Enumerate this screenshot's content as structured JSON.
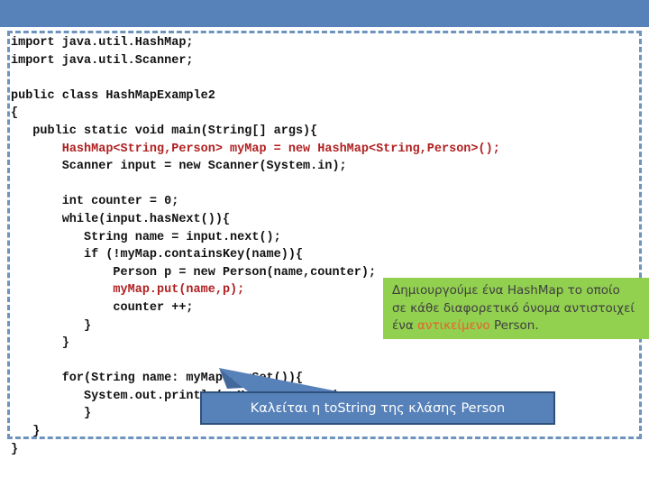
{
  "slide": {
    "header_bar_color": "#5681B9",
    "frame_border_color": "#6E94BE",
    "background": "#ffffff"
  },
  "code": {
    "language": "java",
    "default_color": "#111111",
    "highlight_color": "#B02020",
    "lines": [
      {
        "text": "import java.util.HashMap;",
        "segments": [
          {
            "t": "import java.util.HashMap;",
            "c": "default"
          }
        ]
      },
      {
        "text": "import java.util.Scanner;",
        "segments": [
          {
            "t": "import java.util.Scanner;",
            "c": "default"
          }
        ]
      },
      {
        "text": "",
        "segments": []
      },
      {
        "text": "public class HashMapExample2",
        "segments": [
          {
            "t": "public class HashMapExample2",
            "c": "default"
          }
        ]
      },
      {
        "text": "{",
        "segments": [
          {
            "t": "{",
            "c": "default"
          }
        ]
      },
      {
        "text": "   public static void main(String[] args){",
        "segments": [
          {
            "t": "   public static void main(String[] args){",
            "c": "default"
          }
        ]
      },
      {
        "text": "       HashMap<String,Person> myMap = new HashMap<String,Person>();",
        "segments": [
          {
            "t": "       ",
            "c": "default"
          },
          {
            "t": "HashMap<String,Person> myMap = new HashMap<String,Person>();",
            "c": "red"
          }
        ]
      },
      {
        "text": "       Scanner input = new Scanner(System.in);",
        "segments": [
          {
            "t": "       Scanner input = new Scanner(System.in);",
            "c": "default"
          }
        ]
      },
      {
        "text": "",
        "segments": []
      },
      {
        "text": "       int counter = 0;",
        "segments": [
          {
            "t": "       int counter = 0;",
            "c": "default"
          }
        ]
      },
      {
        "text": "       while(input.hasNext()){",
        "segments": [
          {
            "t": "       while(input.hasNext()){",
            "c": "default"
          }
        ]
      },
      {
        "text": "          String name = input.next();",
        "segments": [
          {
            "t": "          String name = input.next();",
            "c": "default"
          }
        ]
      },
      {
        "text": "          if (!myMap.containsKey(name)){",
        "segments": [
          {
            "t": "          if (!myMap.containsKey(name)){",
            "c": "default"
          }
        ]
      },
      {
        "text": "              Person p = new Person(name,counter);",
        "segments": [
          {
            "t": "              Person p = new Person(name,counter);",
            "c": "default"
          }
        ]
      },
      {
        "text": "              myMap.put(name,p);",
        "segments": [
          {
            "t": "              ",
            "c": "default"
          },
          {
            "t": "myMap.put(name,p);",
            "c": "red"
          }
        ]
      },
      {
        "text": "              counter ++;",
        "segments": [
          {
            "t": "              counter ++;",
            "c": "default"
          }
        ]
      },
      {
        "text": "          }",
        "segments": [
          {
            "t": "          }",
            "c": "default"
          }
        ]
      },
      {
        "text": "       }",
        "segments": [
          {
            "t": "       }",
            "c": "default"
          }
        ]
      },
      {
        "text": "",
        "segments": []
      },
      {
        "text": "       for(String name: myMap.keySet()){",
        "segments": [
          {
            "t": "       for(String name: myMap.keySet()){",
            "c": "default"
          }
        ]
      },
      {
        "text": "          System.out.println(myMap.get(name));",
        "segments": [
          {
            "t": "          System.out.println(myMap.get(name));",
            "c": "default"
          }
        ]
      },
      {
        "text": "          }",
        "segments": [
          {
            "t": "          }",
            "c": "default"
          }
        ]
      },
      {
        "text": "   }",
        "segments": [
          {
            "t": "   }",
            "c": "default"
          }
        ]
      },
      {
        "text": "}",
        "segments": [
          {
            "t": "}",
            "c": "default"
          }
        ]
      }
    ]
  },
  "green_callout": {
    "background": "#92D050",
    "text_color": "#404040",
    "highlight_color": "#E8622A",
    "lines": [
      {
        "parts": [
          {
            "t": "Δημιουργούμε ένα HashMap το οποίο",
            "hl": false
          }
        ]
      },
      {
        "parts": [
          {
            "t": "σε κάθε διαφορετικό όνομα αντιστοιχεί",
            "hl": false
          }
        ]
      },
      {
        "parts": [
          {
            "t": "ένα ",
            "hl": false
          },
          {
            "t": "αντικείμενο",
            "hl": true
          },
          {
            "t": " Person.",
            "hl": false
          }
        ]
      }
    ],
    "full_text": "Δημιουργούμε ένα HashMap το οποίο σε κάθε διαφορετικό όνομα αντιστοιχεί ένα αντικείμενο Person."
  },
  "blue_callout": {
    "background": "#5681B9",
    "border_color": "#2F4F7C",
    "text_color": "#ffffff",
    "label": "Καλείται η toString της κλάσης Person"
  }
}
